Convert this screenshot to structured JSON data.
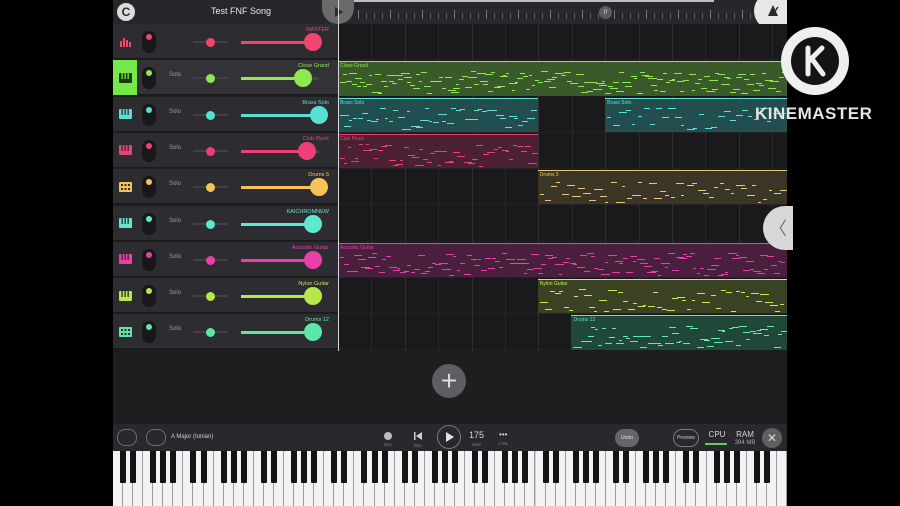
{
  "header": {
    "song_title": "Test FNF Song",
    "app_logo_glyph": "C",
    "loop_marker": "II"
  },
  "tracks": [
    {
      "name": "MASTER",
      "color": "#f0466e",
      "vol": 0.92,
      "solo": "",
      "inst": "mixer"
    },
    {
      "name": "Close Grand",
      "color": "#8ee84f",
      "vol": 0.79,
      "solo": "Solo",
      "inst": "piano",
      "selected": true
    },
    {
      "name": "Brass Solo",
      "color": "#58e0d7",
      "vol": 1.0,
      "solo": "Solo",
      "inst": "piano"
    },
    {
      "name": "Club Pluck",
      "color": "#ef3f78",
      "vol": 0.84,
      "solo": "Solo",
      "inst": "piano"
    },
    {
      "name": "Drums 5",
      "color": "#f6c25a",
      "vol": 1.0,
      "solo": "Solo",
      "inst": "drums"
    },
    {
      "name": "KAICHROMNEW",
      "color": "#5de8cf",
      "vol": 0.92,
      "solo": "Solo",
      "inst": "piano"
    },
    {
      "name": "Acoustic Guitar",
      "color": "#ea3fa8",
      "vol": 0.92,
      "solo": "Solo",
      "inst": "piano"
    },
    {
      "name": "Nylon Guitar",
      "color": "#b6e84a",
      "vol": 0.92,
      "solo": "Solo",
      "inst": "piano"
    },
    {
      "name": "Drums 12",
      "color": "#5ee6a6",
      "vol": 0.92,
      "solo": "Solo",
      "inst": "drums"
    }
  ],
  "clips": [
    {
      "lane": 1,
      "name": "Close Grand",
      "start": 0.0,
      "end": 1.0,
      "color": "#8ee84f",
      "bg": "#3a5a2a",
      "density": 34
    },
    {
      "lane": 2,
      "name": "Brass Solo",
      "start": 0.0,
      "end": 0.445,
      "color": "#5fe0d8",
      "bg": "#224e50",
      "density": 22
    },
    {
      "lane": 2,
      "name": "Brass Solo",
      "start": 0.595,
      "end": 1.0,
      "color": "#5fe0d8",
      "bg": "#224e50",
      "density": 16
    },
    {
      "lane": 3,
      "name": "Club Pluck",
      "start": 0.0,
      "end": 0.445,
      "color": "#ef3f78",
      "bg": "#4b2033",
      "density": 26
    },
    {
      "lane": 4,
      "name": "Drums 5",
      "start": 0.445,
      "end": 1.0,
      "color": "#e9c77a",
      "bg": "#3b3526",
      "density": 18
    },
    {
      "lane": 6,
      "name": "Acoustic Guitar",
      "start": 0.0,
      "end": 1.0,
      "color": "#ea3fa8",
      "bg": "#4a1f3d",
      "density": 28
    },
    {
      "lane": 7,
      "name": "Nylon Guitar",
      "start": 0.445,
      "end": 1.0,
      "color": "#c6ea53",
      "bg": "#3a4223",
      "density": 20
    },
    {
      "lane": 8,
      "name": "Drums 12",
      "start": 0.52,
      "end": 1.0,
      "color": "#65e8b0",
      "bg": "#1f4838",
      "density": 28
    }
  ],
  "footer": {
    "scale": "A Major (Ionian)",
    "rec_label": "REC",
    "rev_label": "REV",
    "play_label": "PLAY",
    "bpm": "175",
    "bpm_label": "BPM",
    "ctrl_label": "CTRL",
    "ctrl_glyph": "•••",
    "undo": "Undo",
    "preview": "Preview",
    "cpu": "CPU",
    "ram": "RAM",
    "ram_value": "394 MB",
    "close_glyph": "✕"
  },
  "side_tab_glyph": "〈",
  "add_glyph": "+",
  "watermark": {
    "text": "KINEMASTER",
    "logo_glyph": "K"
  },
  "keyboard": {
    "white_keys": 67
  }
}
